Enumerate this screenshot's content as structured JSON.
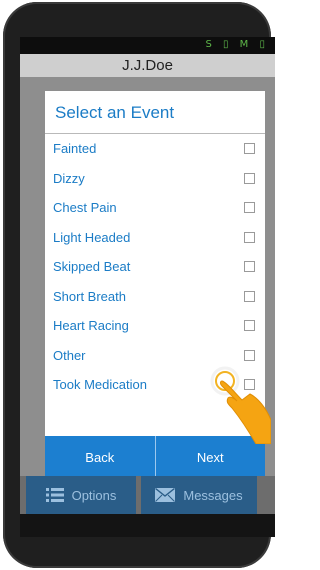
{
  "app": {
    "title": "J.J.Doe"
  },
  "status": {
    "icons": "S ▯ M ▯",
    "color": "#5fb84a"
  },
  "dialog": {
    "title": "Select an Event",
    "events": [
      {
        "label": "Fainted",
        "checked": false
      },
      {
        "label": "Dizzy",
        "checked": false
      },
      {
        "label": "Chest Pain",
        "checked": false
      },
      {
        "label": "Light Headed",
        "checked": false
      },
      {
        "label": "Skipped Beat",
        "checked": false
      },
      {
        "label": "Short Breath",
        "checked": false
      },
      {
        "label": "Heart Racing",
        "checked": false
      },
      {
        "label": "Other",
        "checked": false
      },
      {
        "label": "Took Medication",
        "checked": false
      }
    ],
    "back_label": "Back",
    "next_label": "Next"
  },
  "bottom": {
    "options_label": "Options",
    "options_icon": "list-icon",
    "messages_label": "Messages",
    "messages_icon": "envelope-icon"
  },
  "colors": {
    "accent": "#1b7cc6",
    "button": "#1c7fd0",
    "title_bar": "#cfcfcf"
  }
}
